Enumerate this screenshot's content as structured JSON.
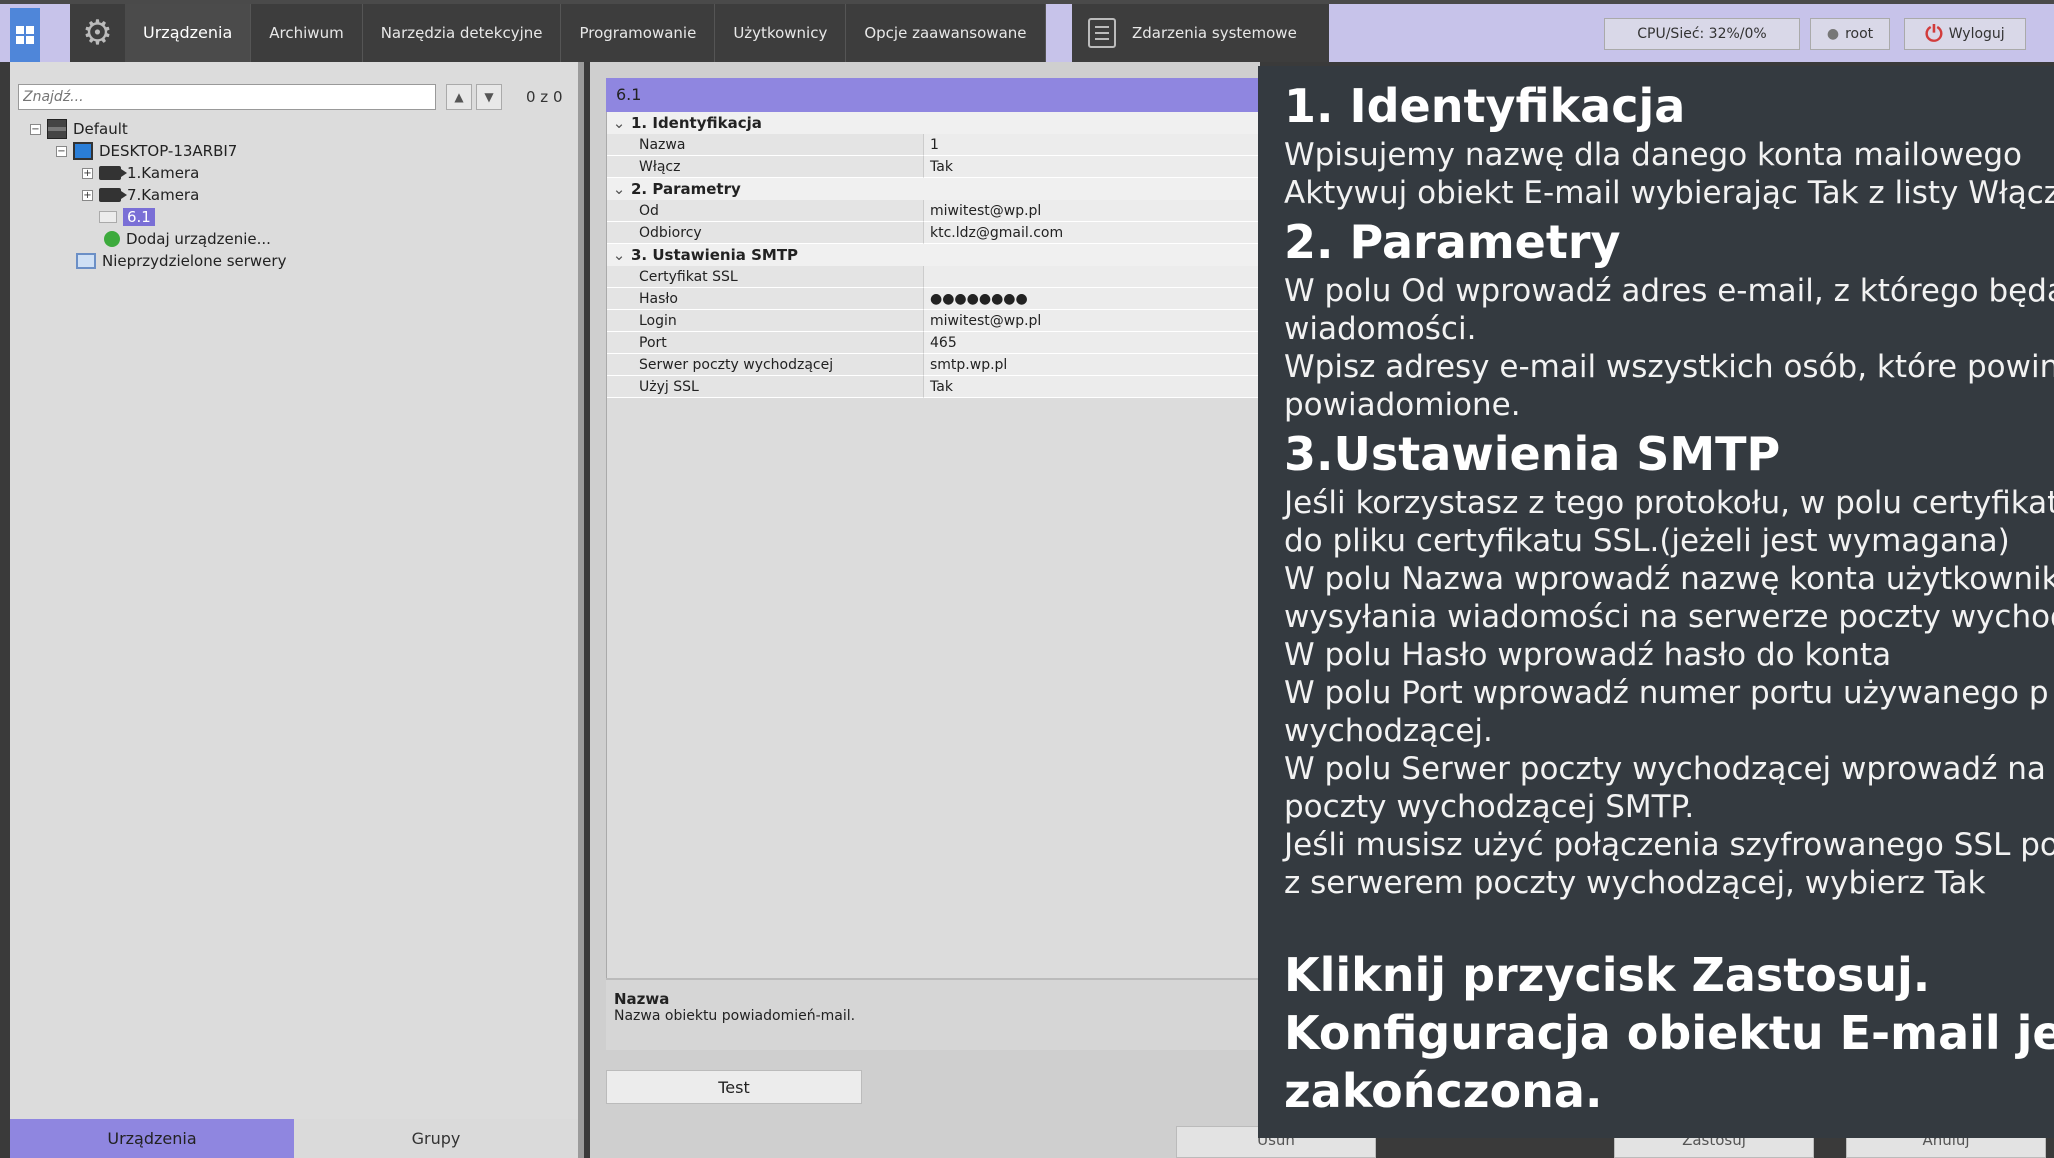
{
  "topbar": {
    "tabs": [
      {
        "label": "Urządzenia",
        "active": true
      },
      {
        "label": "Archiwum",
        "active": false
      },
      {
        "label": "Narzędzia detekcyjne",
        "active": false
      },
      {
        "label": "Programowanie",
        "active": false
      },
      {
        "label": "Użytkownicy",
        "active": false
      },
      {
        "label": "Opcje zaawansowane",
        "active": false
      }
    ],
    "events_label": "Zdarzenia systemowe",
    "cpu_label": "CPU/Sieć: 32%/0%",
    "user_label": "root",
    "logout_label": "Wyloguj"
  },
  "left": {
    "search_placeholder": "Znajdź...",
    "counter": "0 z 0",
    "tree": [
      {
        "label": "Default",
        "icon": "server-icon"
      },
      {
        "label": "DESKTOP-13ARBI7",
        "icon": "computer-icon"
      },
      {
        "label": "1.Kamera",
        "icon": "camera-icon"
      },
      {
        "label": "7.Kamera",
        "icon": "camera-icon"
      },
      {
        "label": "6.1",
        "icon": "mail-icon",
        "selected": true
      },
      {
        "label": "Dodaj urządzenie...",
        "icon": "add-device-icon"
      },
      {
        "label": "Nieprzydzielone serwery",
        "icon": "network-icon"
      }
    ],
    "bottom_tabs": [
      "Urządzenia",
      "Grupy"
    ]
  },
  "center": {
    "header": "6.1",
    "sections": [
      {
        "title": "1. Identyfikacja",
        "rows": [
          {
            "k": "Nazwa",
            "v": "1"
          },
          {
            "k": "Włącz",
            "v": "Tak"
          }
        ]
      },
      {
        "title": "2. Parametry",
        "rows": [
          {
            "k": "Od",
            "v": "miwitest@wp.pl"
          },
          {
            "k": "Odbiorcy",
            "v": "ktc.ldz@gmail.com"
          }
        ]
      },
      {
        "title": "3. Ustawienia SMTP",
        "rows": [
          {
            "k": "Certyfikat SSL",
            "v": ""
          },
          {
            "k": "Hasło",
            "v": "●●●●●●●●"
          },
          {
            "k": "Login",
            "v": "miwitest@wp.pl"
          },
          {
            "k": "Port",
            "v": "465"
          },
          {
            "k": "Serwer poczty wychodzącej",
            "v": "smtp.wp.pl"
          },
          {
            "k": "Użyj SSL",
            "v": "Tak"
          }
        ]
      }
    ],
    "desc_title": "Nazwa",
    "desc_text": "Nazwa obiektu powiadomień-mail.",
    "test_label": "Test",
    "bottom_buttons": [
      "Usuń",
      "Zastosuj",
      "Anuluj"
    ]
  },
  "overlay": {
    "h1": "1.  Identyfikacja",
    "p1": [
      "Wpisujemy nazwę dla danego konta mailowego",
      "Aktywuj obiekt E-mail wybierając Tak z listy Włącz."
    ],
    "h2": "2. Parametry",
    "p2": [
      "W polu Od wprowadź adres e-mail, z którego będą",
      "wiadomości.",
      "Wpisz adresy e-mail wszystkich osób, które powinny",
      "powiadomione."
    ],
    "h3": "3.Ustawienia SMTP",
    "p3": [
      "Jeśli korzystasz z tego protokołu, w polu certyfikatu",
      "do pliku certyfikatu SSL.(jeżeli jest wymagana)",
      "W polu Nazwa wprowadź nazwę konta użytkownika",
      "wysyłania wiadomości na serwerze poczty wychodzącej",
      "W polu Hasło wprowadź hasło do konta",
      "W polu Port wprowadź numer portu używanego p",
      "wychodzącej.",
      "W polu Serwer poczty wychodzącej wprowadź na",
      "poczty wychodzącej SMTP.",
      "Jeśli musisz użyć połączenia szyfrowanego SSL pod",
      "z serwerem poczty wychodzącej, wybierz Tak"
    ],
    "final": [
      "Kliknij przycisk Zastosuj.",
      "Konfiguracja obiektu E-mail jest te",
      "zakończona."
    ]
  }
}
